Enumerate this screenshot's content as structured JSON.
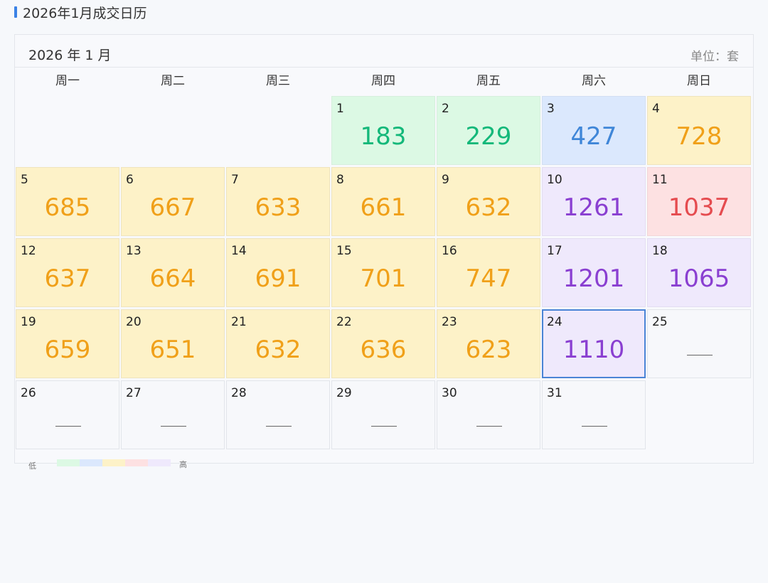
{
  "page": {
    "title": "2026年1月成交日历"
  },
  "calendar": {
    "month_label": "2026 年 1 月",
    "unit_label": "单位：套",
    "weekdays": [
      "周一",
      "周二",
      "周三",
      "周四",
      "周五",
      "周六",
      "周日"
    ],
    "first_weekday_index": 3,
    "empty_value_mark": "——",
    "selected_day": 24,
    "days": [
      {
        "day": "1",
        "count": "183",
        "level": "green"
      },
      {
        "day": "2",
        "count": "229",
        "level": "green"
      },
      {
        "day": "3",
        "count": "427",
        "level": "blue"
      },
      {
        "day": "4",
        "count": "728",
        "level": "yellow"
      },
      {
        "day": "5",
        "count": "685",
        "level": "yellow"
      },
      {
        "day": "6",
        "count": "667",
        "level": "yellow"
      },
      {
        "day": "7",
        "count": "633",
        "level": "yellow"
      },
      {
        "day": "8",
        "count": "661",
        "level": "yellow"
      },
      {
        "day": "9",
        "count": "632",
        "level": "yellow"
      },
      {
        "day": "10",
        "count": "1261",
        "level": "purple"
      },
      {
        "day": "11",
        "count": "1037",
        "level": "red"
      },
      {
        "day": "12",
        "count": "637",
        "level": "yellow"
      },
      {
        "day": "13",
        "count": "664",
        "level": "yellow"
      },
      {
        "day": "14",
        "count": "691",
        "level": "yellow"
      },
      {
        "day": "15",
        "count": "701",
        "level": "yellow"
      },
      {
        "day": "16",
        "count": "747",
        "level": "yellow"
      },
      {
        "day": "17",
        "count": "1201",
        "level": "purple"
      },
      {
        "day": "18",
        "count": "1065",
        "level": "purple"
      },
      {
        "day": "19",
        "count": "659",
        "level": "yellow"
      },
      {
        "day": "20",
        "count": "651",
        "level": "yellow"
      },
      {
        "day": "21",
        "count": "632",
        "level": "yellow"
      },
      {
        "day": "22",
        "count": "636",
        "level": "yellow"
      },
      {
        "day": "23",
        "count": "623",
        "level": "yellow"
      },
      {
        "day": "24",
        "count": "1110",
        "level": "purple"
      },
      {
        "day": "25",
        "count": null,
        "level": "none"
      },
      {
        "day": "26",
        "count": null,
        "level": "none"
      },
      {
        "day": "27",
        "count": null,
        "level": "none"
      },
      {
        "day": "28",
        "count": null,
        "level": "none"
      },
      {
        "day": "29",
        "count": null,
        "level": "none"
      },
      {
        "day": "30",
        "count": null,
        "level": "none"
      },
      {
        "day": "31",
        "count": null,
        "level": "none"
      }
    ]
  },
  "legend": {
    "low_label": "低",
    "high_label": "高",
    "colors": [
      "#dcf9e4",
      "#dbe8fd",
      "#fdf2c8",
      "#fde1e2",
      "#efe9fc"
    ]
  }
}
